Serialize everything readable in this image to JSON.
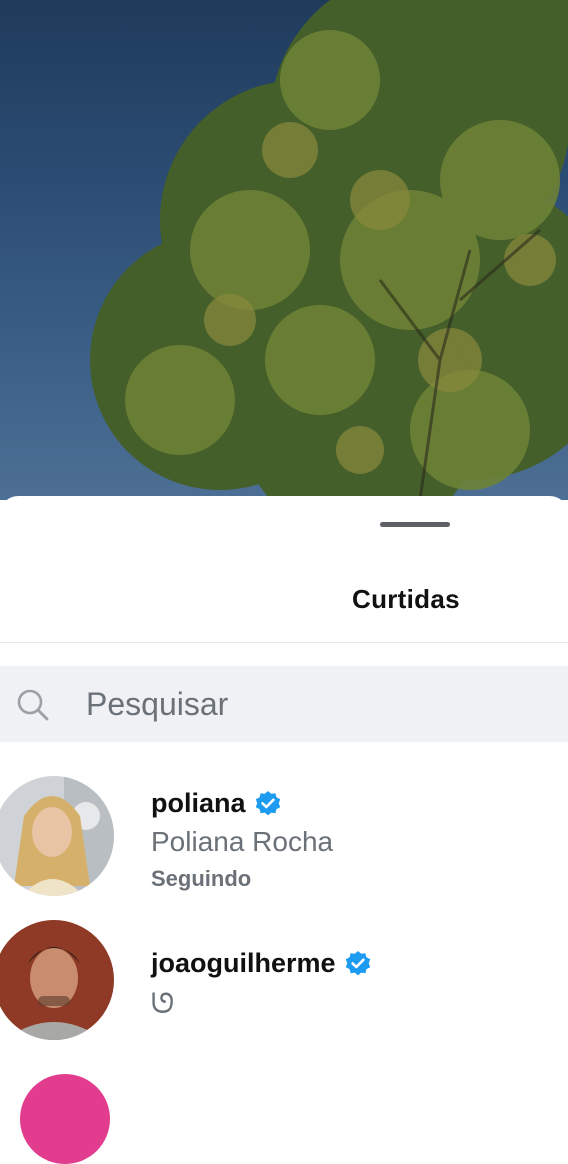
{
  "sheet": {
    "title": "Curtidas"
  },
  "search": {
    "placeholder": "Pesquisar",
    "value": ""
  },
  "users": [
    {
      "username": "poliana",
      "full_name": "Poliana Rocha",
      "status": "Seguindo",
      "verified": true
    },
    {
      "username": "joaoguilherme",
      "full_name": "ᘎ",
      "verified": true
    }
  ],
  "colors": {
    "verified_badge": "#1d9bf0",
    "secondary_text": "#6b7178",
    "search_background": "#eff1f4"
  },
  "icons": {
    "search": "search-icon",
    "verified": "verified-badge-icon"
  }
}
